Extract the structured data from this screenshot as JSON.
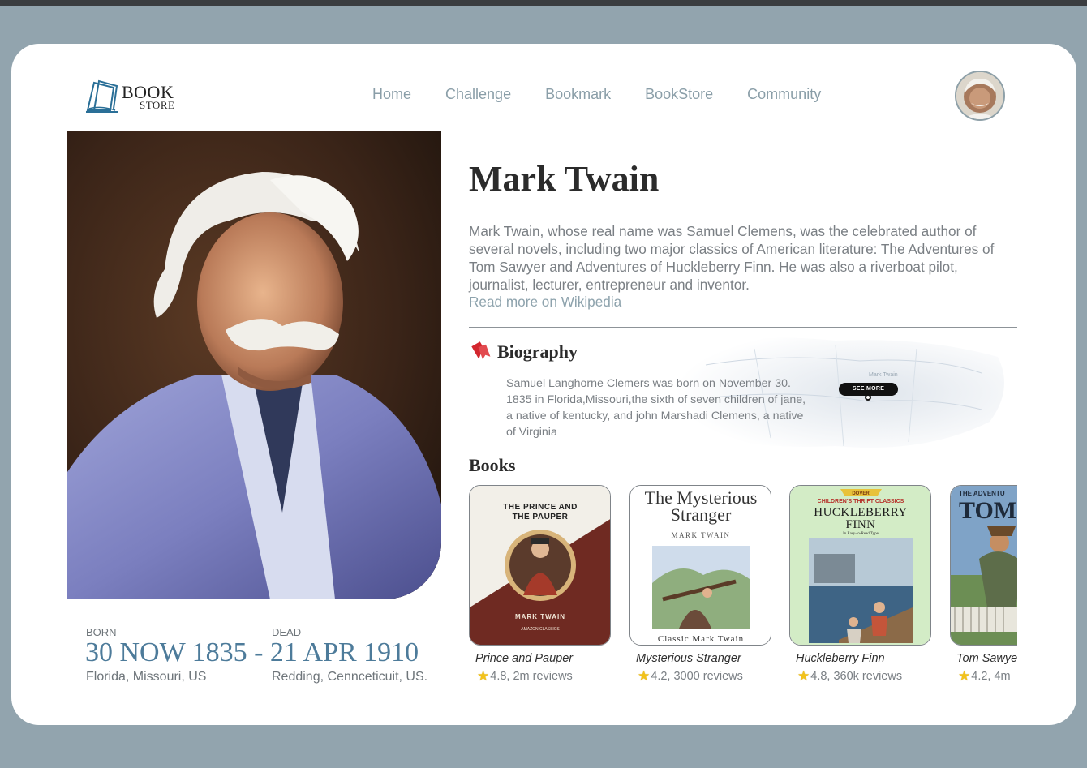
{
  "brand": {
    "logo_top": "BOOK",
    "logo_bottom": "STORE"
  },
  "nav": {
    "items": [
      "Home",
      "Challenge",
      "Bookmark",
      "BookStore",
      "Community"
    ]
  },
  "author": {
    "name": "Mark Twain",
    "intro": "Mark Twain, whose real name was Samuel Clemens, was the celebrated author of several novels, including two major classics of American literature: The Adventures of Tom Sawyer and Adventures of Huckleberry Finn. He was also a riverboat pilot, journalist, lecturer, entrepreneur and inventor.",
    "read_more": "Read more on Wikipedia"
  },
  "biography": {
    "title": "Biography",
    "text": "Samuel Langhorne Clemers was born on November 30. 1835 in Florida,Missouri,the sixth of seven children of jane, a native of kentucky, and john Marshadi Clemens, a native of Virginia",
    "see_more": "SEE MORE",
    "map_label": "Mark Twain"
  },
  "books": {
    "title": "Books",
    "items": [
      {
        "title": "Prince and Pauper",
        "rating": "4.8, 2m reviews",
        "cover_line1": "THE PRINCE AND",
        "cover_line2": "THE PAUPER",
        "cover_author": "MARK TWAIN",
        "cover_series": "AMAZON CLASSICS"
      },
      {
        "title": "Mysterious Stranger",
        "rating": "4.2, 3000 reviews",
        "cover_line1": "The Mysterious",
        "cover_line2": "Stranger",
        "cover_author": "MARK TWAIN",
        "cover_series": "Classic Mark Twain"
      },
      {
        "title": "Huckleberry Finn",
        "rating": "4.8, 360k reviews",
        "cover_line1": "HUCKLEBERRY",
        "cover_line2": "FINN",
        "cover_author": "In Easy-to-Read Type",
        "cover_series": "CHILDREN'S THRIFT CLASSICS",
        "cover_publisher": "DOVER"
      },
      {
        "title": "Tom Sawyer",
        "rating": "4.2, 4m",
        "cover_line1": "THE ADVENTU",
        "cover_line2": "TOM SA"
      }
    ]
  },
  "born": {
    "label": "BORN",
    "date": "30 NOW 1835",
    "place": "Florida, Missouri, US"
  },
  "dead": {
    "label": "DEAD",
    "date": "21 APR 1910",
    "place": "Redding, Cennceticuit, US."
  },
  "dates_separator": " - ",
  "colors": {
    "background": "#92a4ae",
    "accent": "#4d7b9a",
    "nav": "#8a9ea8",
    "star": "#f2c21a"
  }
}
